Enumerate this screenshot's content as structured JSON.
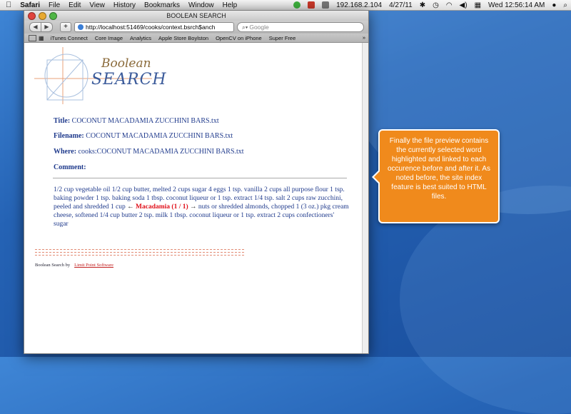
{
  "menubar": {
    "apple": "",
    "items": [
      "Safari",
      "File",
      "Edit",
      "View",
      "History",
      "Bookmarks",
      "Window",
      "Help"
    ],
    "ip": "192.168.2.104",
    "date": "4/27/11",
    "clock": "Wed 12:56:14 AM"
  },
  "window": {
    "title": "BOOLEAN SEARCH",
    "url": "http://localhost:51469/cooks/context.bsrch$anch",
    "search_placeholder": "Google",
    "bookmarks": [
      "iTunes Connect",
      "Core Image",
      "Analytics",
      "Apple Store Boylston",
      "OpenCV on iPhone",
      "Super Free"
    ],
    "more": "»"
  },
  "page": {
    "logo_line1": "Boolean",
    "logo_line2": "SEARCH",
    "title_label": "Title:",
    "title_value": "COCONUT MACADAMIA ZUCCHINI BARS.txt",
    "filename_label": "Filename:",
    "filename_value": "COCONUT MACADAMIA ZUCCHINI BARS.txt",
    "where_label": "Where:",
    "where_value": "cooks:COCONUT MACADAMIA ZUCCHINI BARS.txt",
    "comment_label": "Comment:",
    "text_before": "1/2 cup vegetable oil 1/2 cup butter, melted 2 cups sugar 4 eggs 1 tsp. vanilla 2 cups all purpose flour 1 tsp. baking powder 1 tsp. baking soda 1 tbsp. coconut liqueur or 1 tsp. extract 1/4 tsp. salt 2 cups raw zucchini, peeled and shredded 1 cup",
    "arrow_left": "←",
    "highlight": "Macadamia (1 / 1)",
    "arrow_right": "→",
    "text_after": "nuts or shredded almonds, chopped 1 (3 oz.) pkg cream cheese, softened 1/4 cup butter 2 tsp. milk 1 tbsp. coconut liqueur or 1 tsp. extract 2 cups confectioners' sugar",
    "footer_text": "Boolean Search by",
    "footer_link": "Limit Point Software"
  },
  "callout": {
    "text": "Finally the file preview contains the currently selected word highlighted and linked to each occurence before and after it. As noted before, the site index feature is best suited to HTML files."
  },
  "colors": {
    "callout": "#f08a1c",
    "link_text": "#1f3a8c",
    "highlight": "#e0101a"
  }
}
